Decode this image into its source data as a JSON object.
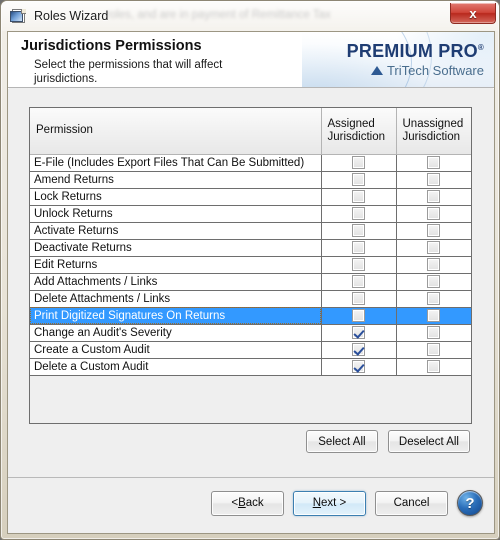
{
  "window": {
    "title": "Roles Wizard",
    "icon": "wizard-document-icon",
    "close_label": "x",
    "ghost_text": "roles, and are in payment of Remittance Tax"
  },
  "banner": {
    "title": "Jurisdictions Permissions",
    "subtitle": "Select the permissions that will affect jurisdictions.",
    "logo_main": "PREMIUM PRO",
    "logo_registered": "®",
    "logo_sub": "TriTech Software"
  },
  "grid": {
    "columns": [
      "Permission",
      "Assigned Jurisdiction",
      "Unassigned Jurisdiction"
    ],
    "rows": [
      {
        "name": "E-File (Includes Export Files That Can Be Submitted)",
        "assigned": false,
        "unassigned": false,
        "selected": false
      },
      {
        "name": "Amend Returns",
        "assigned": false,
        "unassigned": false,
        "selected": false
      },
      {
        "name": "Lock Returns",
        "assigned": false,
        "unassigned": false,
        "selected": false
      },
      {
        "name": "Unlock Returns",
        "assigned": false,
        "unassigned": false,
        "selected": false
      },
      {
        "name": "Activate Returns",
        "assigned": false,
        "unassigned": false,
        "selected": false
      },
      {
        "name": "Deactivate Returns",
        "assigned": false,
        "unassigned": false,
        "selected": false
      },
      {
        "name": "Edit Returns",
        "assigned": false,
        "unassigned": false,
        "selected": false
      },
      {
        "name": "Add Attachments / Links",
        "assigned": false,
        "unassigned": false,
        "selected": false
      },
      {
        "name": "Delete Attachments / Links",
        "assigned": false,
        "unassigned": false,
        "selected": false
      },
      {
        "name": "Print Digitized Signatures On Returns",
        "assigned": false,
        "unassigned": false,
        "selected": true
      },
      {
        "name": "Change an Audit's Severity",
        "assigned": true,
        "unassigned": false,
        "selected": false
      },
      {
        "name": "Create a Custom Audit",
        "assigned": true,
        "unassigned": false,
        "selected": false
      },
      {
        "name": "Delete a Custom Audit",
        "assigned": true,
        "unassigned": false,
        "selected": false
      }
    ]
  },
  "actions": {
    "select_all": "Select All",
    "deselect_all": "Deselect All"
  },
  "footer": {
    "back": "< Back",
    "back_mnemonic": "B",
    "next": "Next >",
    "next_mnemonic": "N",
    "cancel": "Cancel",
    "help": "?"
  },
  "colors": {
    "selection_blue": "#3399ff",
    "logo_navy": "#1f3d73",
    "logo_sub_blue": "#4a6e8e",
    "checkmark_blue": "#2a4f9b",
    "default_button_border": "#3c7fb1",
    "close_red": "#cf4338"
  }
}
